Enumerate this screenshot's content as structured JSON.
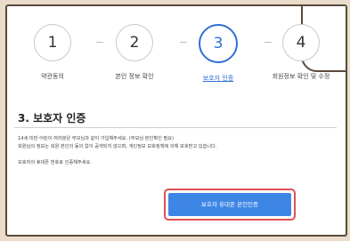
{
  "steps": [
    {
      "number": "1",
      "label": "약관동의",
      "active": false
    },
    {
      "number": "2",
      "label": "본인 정보 확인",
      "active": false
    },
    {
      "number": "3",
      "label": "보호자 인증",
      "active": true
    },
    {
      "number": "4",
      "label": "회원정보 확인 및 수정",
      "active": false
    }
  ],
  "section": {
    "title": "3. 보호자 인증",
    "lines": [
      "14세 미만 어린이 여러분은 부모님과 같이 가입해주세요. (부모님 본인확인 필요)",
      "회원님의 정보는 회원 본인의 동의 없이 공개되지 않으며, 개인정보 보호정책에 의해 보호받고 있습니다.",
      "보호자의 휴대폰 번호로 인증해주세요."
    ]
  },
  "button": {
    "label": "보호자 휴대폰 본인인증"
  },
  "colors": {
    "accent": "#2f6fd6",
    "button": "#3e86e6",
    "highlight": "#e05252"
  }
}
